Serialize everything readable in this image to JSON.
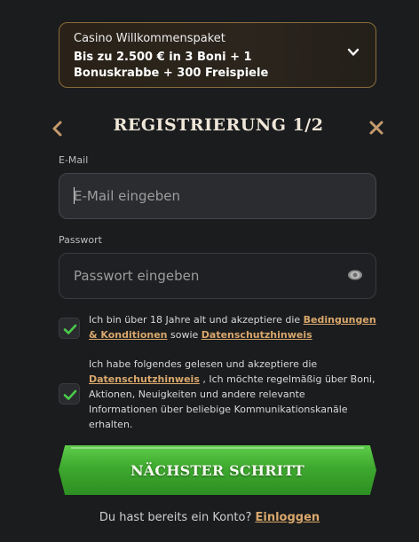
{
  "promo": {
    "title": "Casino Willkommenspaket",
    "text": "Bis zu 2.500 € in 3 Boni + 1 Bonuskrabbe + 300 Freispiele",
    "chevron_icon": "chevron-down-icon"
  },
  "header": {
    "title": "REGISTRIERUNG 1/2",
    "back_icon": "chevron-left-icon",
    "close_icon": "close-icon"
  },
  "form": {
    "email": {
      "label": "E-Mail",
      "placeholder": "E-Mail eingeben",
      "value": ""
    },
    "password": {
      "label": "Passwort",
      "placeholder": "Passwort eingeben",
      "value": "",
      "visibility_icon": "eye-icon"
    }
  },
  "consents": [
    {
      "checked": true,
      "text_before": "Ich bin über 18 Jahre alt und akzeptiere die ",
      "link1": "Bedingungen & Konditionen",
      "text_mid": " sowie ",
      "link2": "Datenschutzhinweis"
    },
    {
      "checked": true,
      "text_before": "Ich habe folgendes gelesen und akzeptiere die ",
      "link1": "Datenschutzhinweis",
      "text_after": " , Ich möchte regelmäßig über Boni, Aktionen, Neuigkeiten und andere relevante Informationen über beliebige Kommunikationskanäle erhalten."
    }
  ],
  "cta": {
    "label": "NÄCHSTER SCHRITT"
  },
  "footer": {
    "question": "Du hast bereits ein Konto?",
    "login_link": "Einloggen"
  },
  "colors": {
    "background": "#1b1c1e",
    "promo_border": "#8a6d3b",
    "accent_link": "#d9a86c",
    "check_green": "#4bc94b",
    "cta_green": "#3ea92f",
    "close_x": "#c49a6c"
  }
}
